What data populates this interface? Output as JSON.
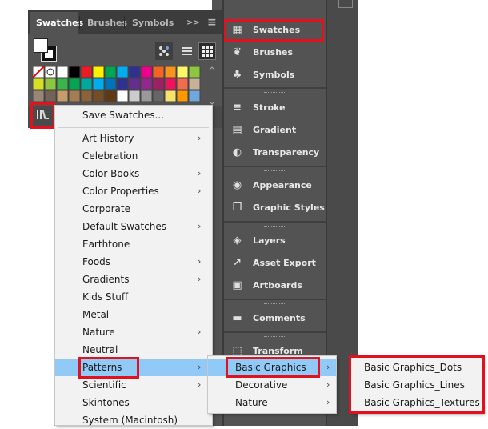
{
  "swatches_panel": {
    "tabs": [
      {
        "label": "Swatches"
      },
      {
        "label": "Brushes"
      },
      {
        "label": "Symbols"
      }
    ],
    "menu_chevron": ">>",
    "menu_lines": "≡"
  },
  "dock": {
    "items": [
      {
        "label": "Swatches",
        "icon": "swatches-icon",
        "glyph": "▦"
      },
      {
        "label": "Brushes",
        "icon": "brush-icon",
        "glyph": "❦"
      },
      {
        "label": "Symbols",
        "icon": "club-icon",
        "glyph": "♣"
      },
      {
        "label": "Stroke",
        "icon": "stroke-lines-icon",
        "glyph": "≡"
      },
      {
        "label": "Gradient",
        "icon": "gradient-icon",
        "glyph": "▤"
      },
      {
        "label": "Transparency",
        "icon": "transparency-icon",
        "glyph": "◐"
      },
      {
        "label": "Appearance",
        "icon": "appearance-icon",
        "glyph": "◉"
      },
      {
        "label": "Graphic Styles",
        "icon": "graphic-styles-icon",
        "glyph": "❒"
      },
      {
        "label": "Layers",
        "icon": "layers-icon",
        "glyph": "◈"
      },
      {
        "label": "Asset Export",
        "icon": "export-icon",
        "glyph": "↗"
      },
      {
        "label": "Artboards",
        "icon": "artboards-icon",
        "glyph": "▣"
      },
      {
        "label": "Comments",
        "icon": "comment-icon",
        "glyph": "▬"
      },
      {
        "label": "Transform",
        "icon": "transform-icon",
        "glyph": "⬚"
      }
    ]
  },
  "library_menu": {
    "save": "Save Swatches...",
    "items": [
      {
        "label": "Art History",
        "submenu": true
      },
      {
        "label": "Celebration",
        "submenu": false
      },
      {
        "label": "Color Books",
        "submenu": true
      },
      {
        "label": "Color Properties",
        "submenu": true
      },
      {
        "label": "Corporate",
        "submenu": false
      },
      {
        "label": "Default Swatches",
        "submenu": true
      },
      {
        "label": "Earthtone",
        "submenu": false
      },
      {
        "label": "Foods",
        "submenu": true
      },
      {
        "label": "Gradients",
        "submenu": true
      },
      {
        "label": "Kids Stuff",
        "submenu": false
      },
      {
        "label": "Metal",
        "submenu": false
      },
      {
        "label": "Nature",
        "submenu": true
      },
      {
        "label": "Neutral",
        "submenu": false
      },
      {
        "label": "Patterns",
        "submenu": true
      },
      {
        "label": "Scientific",
        "submenu": true
      },
      {
        "label": "Skintones",
        "submenu": false
      },
      {
        "label": "System (Macintosh)",
        "submenu": false
      }
    ]
  },
  "patterns_menu": {
    "items": [
      {
        "label": "Basic Graphics",
        "submenu": true
      },
      {
        "label": "Decorative",
        "submenu": true
      },
      {
        "label": "Nature",
        "submenu": true
      }
    ]
  },
  "basic_graphics_menu": {
    "items": [
      {
        "label": "Basic Graphics_Dots"
      },
      {
        "label": "Basic Graphics_Lines"
      },
      {
        "label": "Basic Graphics_Textures"
      }
    ]
  },
  "arrow_glyph": "›",
  "colors": {
    "highlight": "#91c9f7",
    "callout_red": "#e0121f",
    "panel_gray": "#535353"
  }
}
